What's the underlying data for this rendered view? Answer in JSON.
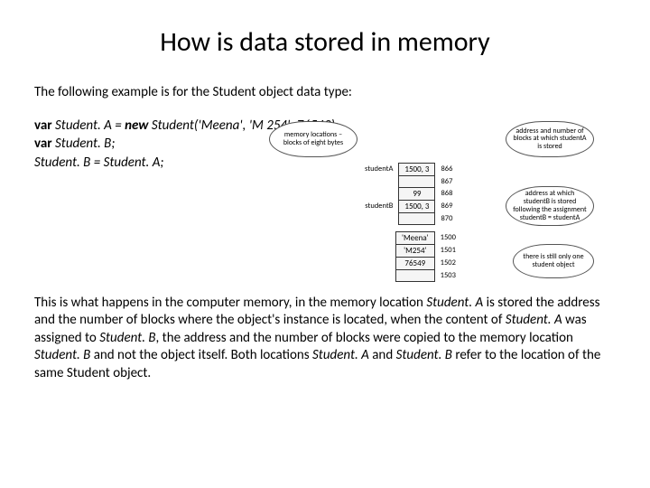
{
  "title": "How is data stored in memory",
  "intro": "The following example is for the Student object data type:",
  "code": {
    "l1a": "var",
    "l1b": " Student. A = ",
    "l1c": "new",
    "l1d": " Student('Meena', 'M 254', 76549);",
    "l2a": "var",
    "l2b": " Student. B;",
    "l3": "Student. B = Student. A;"
  },
  "bubbles": {
    "tl": "memory locations – blocks of eight bytes",
    "tr": "address and number of blocks at which studentA is stored",
    "mr": "address at which studentB is stored following the assignment studentB = studentA",
    "br": "there is still only one student object"
  },
  "mem": {
    "r1_lbl": "studentA",
    "r1_val": "1500, 3",
    "r1_addr": "866",
    "r2_addr": "867",
    "r3_val": "99",
    "r3_addr": "868",
    "r4_lbl": "studentB",
    "r4_val": "1500, 3",
    "r4_addr": "869",
    "r5_addr": "870"
  },
  "obj": {
    "v1": "'Meena'",
    "a1": "1500",
    "v2": "'M254'",
    "a2": "1501",
    "v3": "76549",
    "a3": "1502",
    "a4": "1503"
  },
  "explanation": {
    "p1": " This is what happens in the computer memory, in the memory location ",
    "i1": "Student. A",
    "p2": " is stored the address and the number of blocks where the object's instance is located, when the content of ",
    "i2": "Student. A",
    "p3": " was assigned to ",
    "i3": "Student. B",
    "p4": ", the address and the number of blocks were copied to the memory location ",
    "i4": "Student. B",
    "p5": " and not the object itself. Both locations ",
    "i5": "Student. A",
    "p6": " and ",
    "i6": "Student. B",
    "p7": " refer to the location of the same Student object."
  }
}
